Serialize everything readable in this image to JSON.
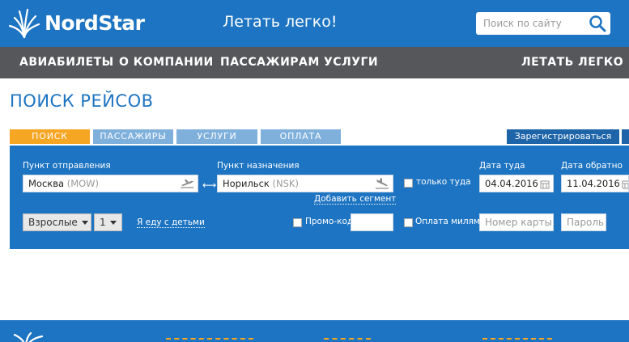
{
  "header": {
    "logo_text": "NordStar",
    "slogan": "Летать легко!",
    "search_placeholder": "Поиск по сайту"
  },
  "nav": {
    "items": [
      "АВИАБИЛЕТЫ",
      "О КОМПАНИИ",
      "ПАССАЖИРАМ",
      "УСЛУГИ"
    ],
    "right_item": "ЛЕТАТЬ ЛЕГКО"
  },
  "page_title": "ПОИСК РЕЙСОВ",
  "tabs": [
    {
      "label": "ПОИСК",
      "active": true
    },
    {
      "label": "ПАССАЖИРЫ",
      "active": false
    },
    {
      "label": "УСЛУГИ",
      "active": false
    },
    {
      "label": "ОПЛАТА",
      "active": false
    }
  ],
  "register_label": "Зарегистрироваться",
  "form": {
    "origin_label": "Пункт отправления",
    "origin_city": "Москва",
    "origin_code": "(MOW)",
    "dest_label": "Пункт назначения",
    "dest_city": "Норильск",
    "dest_code": "(NSK)",
    "add_segment": "Добавить сегмент",
    "one_way_label": "только туда",
    "date_out_label": "Дата туда",
    "date_out": "04.04.2016",
    "date_back_label": "Дата обратно",
    "date_back": "11.04.2016",
    "passenger_type": "Взрослые",
    "passenger_count": "1",
    "with_children": "Я еду с детьми",
    "promo_label": "Промо-код",
    "miles_label": "Оплата милями",
    "card_placeholder": "Номер карты",
    "password_placeholder": "Пароль"
  },
  "colors": {
    "brand_blue": "#1d74c2",
    "nav_gray": "#55575b",
    "active_tab": "#f5a623",
    "inactive_tab": "#7fb0dc"
  }
}
